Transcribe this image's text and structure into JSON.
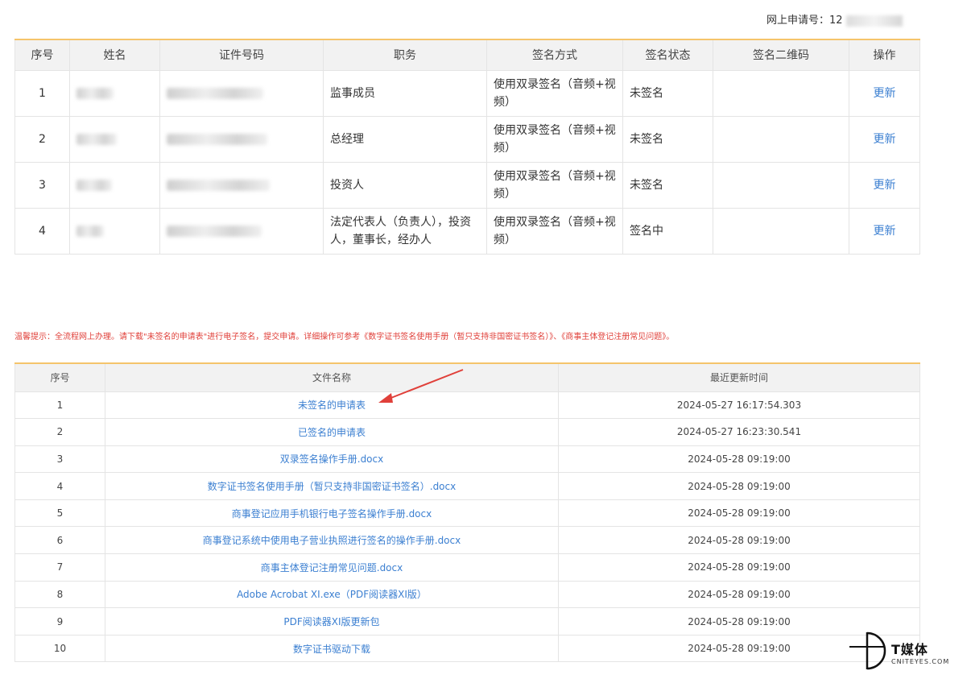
{
  "application_number": {
    "label": "网上申请号：12"
  },
  "signer_table": {
    "headers": [
      "序号",
      "姓名",
      "证件号码",
      "职务",
      "签名方式",
      "签名状态",
      "签名二维码",
      "操作"
    ],
    "rows": [
      {
        "index": "1",
        "role": "监事成员",
        "method": "使用双录签名（音频+视频）",
        "status": "未签名",
        "action": "更新"
      },
      {
        "index": "2",
        "role": "总经理",
        "method": "使用双录签名（音频+视频）",
        "status": "未签名",
        "action": "更新"
      },
      {
        "index": "3",
        "role": "投资人",
        "method": "使用双录签名（音频+视频）",
        "status": "未签名",
        "action": "更新"
      },
      {
        "index": "4",
        "role": "法定代表人（负责人），投资人，董事长，经办人",
        "method": "使用双录签名（音频+视频）",
        "status": "签名中",
        "action": "更新"
      }
    ]
  },
  "tip": "温馨提示：全流程网上办理。请下载\"未签名的申请表\"进行电子签名，提交申请。详细操作可参考《数字证书签名使用手册（暂只支持非国密证书签名）》、《商事主体登记注册常见问题》。",
  "file_table": {
    "headers": [
      "序号",
      "文件名称",
      "最近更新时间"
    ],
    "rows": [
      {
        "index": "1",
        "name": "未签名的申请表",
        "time": "2024-05-27 16:17:54.303"
      },
      {
        "index": "2",
        "name": "已签名的申请表",
        "time": "2024-05-27 16:23:30.541"
      },
      {
        "index": "3",
        "name": "双录签名操作手册.docx",
        "time": "2024-05-28 09:19:00"
      },
      {
        "index": "4",
        "name": "数字证书签名使用手册（暂只支持非国密证书签名）.docx",
        "time": "2024-05-28 09:19:00"
      },
      {
        "index": "5",
        "name": "商事登记应用手机银行电子签名操作手册.docx",
        "time": "2024-05-28 09:19:00"
      },
      {
        "index": "6",
        "name": "商事登记系统中使用电子营业执照进行签名的操作手册.docx",
        "time": "2024-05-28 09:19:00"
      },
      {
        "index": "7",
        "name": "商事主体登记注册常见问题.docx",
        "time": "2024-05-28 09:19:00"
      },
      {
        "index": "8",
        "name": "Adobe Acrobat XI.exe（PDF阅读器XI版）",
        "time": "2024-05-28 09:19:00"
      },
      {
        "index": "9",
        "name": "PDF阅读器XI版更新包",
        "time": "2024-05-28 09:19:00"
      },
      {
        "index": "10",
        "name": "数字证书驱动下载",
        "time": "2024-05-28 09:19:00"
      }
    ]
  },
  "watermark": {
    "brand": "T媒体",
    "site": "CNITEYES.COM"
  },
  "colors": {
    "link": "#3b7fd1",
    "tip": "#e0403a",
    "header_border": "#f5c46b",
    "arrow": "#e0403a"
  }
}
